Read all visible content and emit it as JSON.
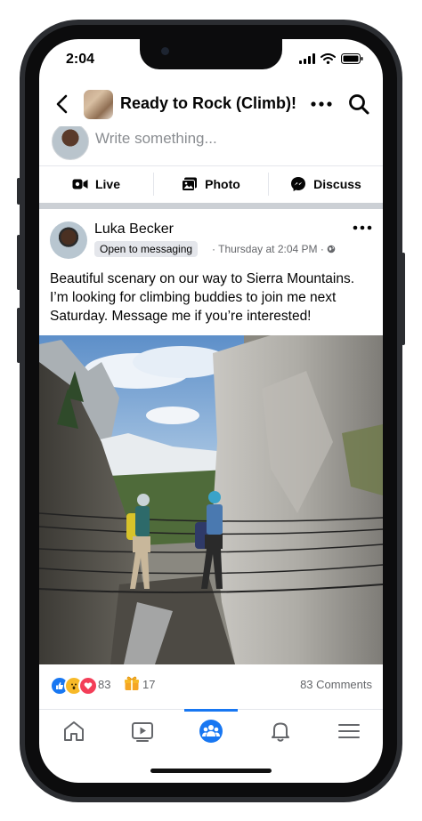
{
  "status_bar": {
    "time": "2:04"
  },
  "header": {
    "group_title": "Ready to Rock (Climb)!"
  },
  "composer": {
    "placeholder": "Write something..."
  },
  "actions": [
    {
      "label": "Live",
      "icon": "video-camera-icon"
    },
    {
      "label": "Photo",
      "icon": "photo-icon"
    },
    {
      "label": "Discuss",
      "icon": "messenger-icon"
    }
  ],
  "post": {
    "author": "Luka Becker",
    "badge": "Open to messaging",
    "timestamp": "Thursday at 2:04 PM",
    "separator": "·",
    "text": "Beautiful scenary on our way to Sierra Mountains. I’m looking for climbing buddies to join me next Saturday. Message me if you’re interested!",
    "reaction_count": "83",
    "care_count": "17",
    "comments": "83 Comments"
  },
  "tabs": [
    {
      "name": "home-icon"
    },
    {
      "name": "video-icon"
    },
    {
      "name": "groups-icon",
      "active": true
    },
    {
      "name": "bell-icon"
    },
    {
      "name": "menu-icon"
    }
  ],
  "colors": {
    "accent": "#1877f2",
    "text": "#050505",
    "muted": "#65676b"
  }
}
